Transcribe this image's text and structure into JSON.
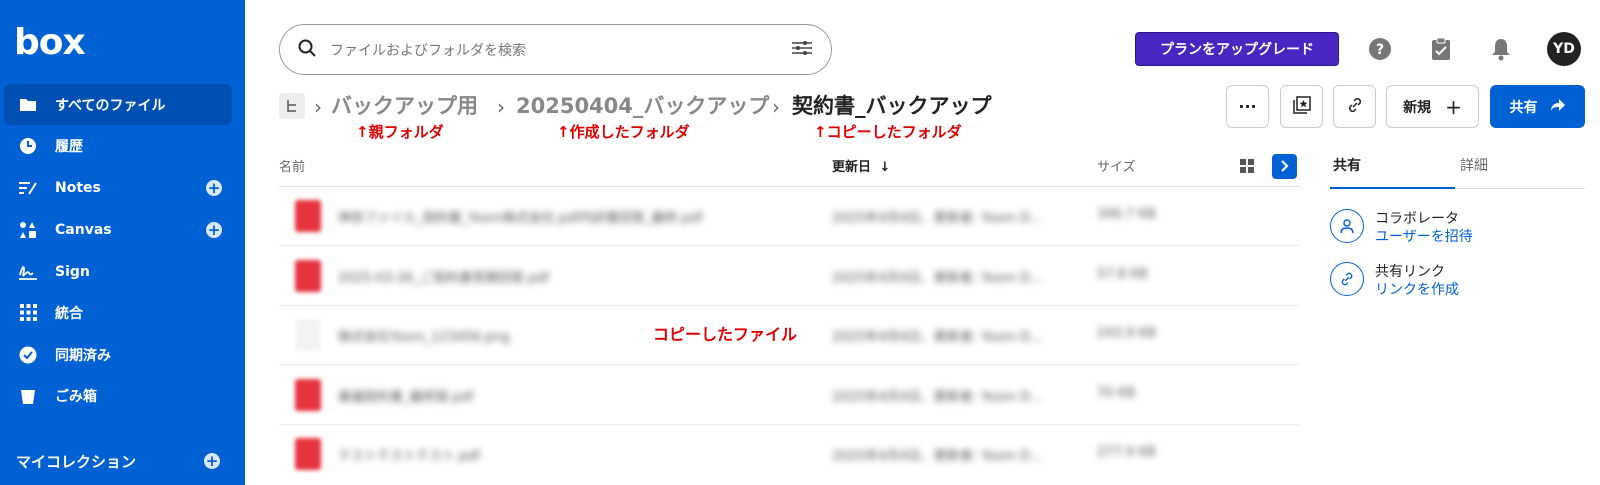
{
  "brand": {
    "logo": "box",
    "accent": "#0061d5",
    "upgrade_color": "#4826c2",
    "annotation_color": "#e00000"
  },
  "sidebar": {
    "items": [
      {
        "label": "すべてのファイル",
        "icon": "folder-icon",
        "active": true
      },
      {
        "label": "履歴",
        "icon": "clock-icon"
      },
      {
        "label": "Notes",
        "icon": "notes-icon",
        "plus": true
      },
      {
        "label": "Canvas",
        "icon": "canvas-icon",
        "plus": true
      },
      {
        "label": "Sign",
        "icon": "sign-icon"
      },
      {
        "label": "統合",
        "icon": "apps-grid-icon"
      },
      {
        "label": "同期済み",
        "icon": "check-circle-icon"
      },
      {
        "label": "ごみ箱",
        "icon": "trash-icon"
      }
    ],
    "collections_label": "マイコレクション"
  },
  "header": {
    "search_placeholder": "ファイルおよびフォルダを検索",
    "upgrade_label": "プランをアップグレード",
    "avatar_initials": "YD"
  },
  "breadcrumb": {
    "items": [
      "バックアップ用",
      "20250404_バックアップ",
      "契約書_バックアップ"
    ],
    "annotations": [
      "↑親フォルダ",
      "↑作成したフォルダ",
      "↑コピーしたフォルダ"
    ]
  },
  "toolbar": {
    "more_label": "···",
    "new_label": "新規",
    "share_label": "共有"
  },
  "table": {
    "columns": {
      "name": "名前",
      "updated": "更新日",
      "size": "サイズ"
    },
    "rows": [
      {
        "name": "神奈ファイル_契約書_Yoom株式会社.pdf内訳書回答_最終.pdf",
        "date": "2025年4月4日、更新者: Yoom D...",
        "size": "346.7 KB",
        "type": "pdf"
      },
      {
        "name": "2025-03-26_ご契約書見積回答.pdf",
        "date": "2025年4月4日、更新者: Yoom D...",
        "size": "57.8 KB",
        "type": "pdf"
      },
      {
        "name": "株式会社Yoom_123456.png",
        "date": "2025年4月4日、更新者: Yoom D...",
        "size": "243.9 KB",
        "type": "png"
      },
      {
        "name": "稟議契約書_最終版.pdf",
        "date": "2025年4月4日、更新者: Yoom D...",
        "size": "70 KB",
        "type": "pdf"
      },
      {
        "name": "テストテストテスト.pdf",
        "date": "2025年4月4日、更新者: Yoom D...",
        "size": "277.9 KB",
        "type": "pdf"
      }
    ],
    "copy_annotation": "コピーしたファイル"
  },
  "sidepanel": {
    "tabs": [
      "共有",
      "詳細"
    ],
    "collaborators": {
      "title": "コラボレータ",
      "action": "ユーザーを招待"
    },
    "shared_link": {
      "title": "共有リンク",
      "action": "リンクを作成"
    }
  }
}
